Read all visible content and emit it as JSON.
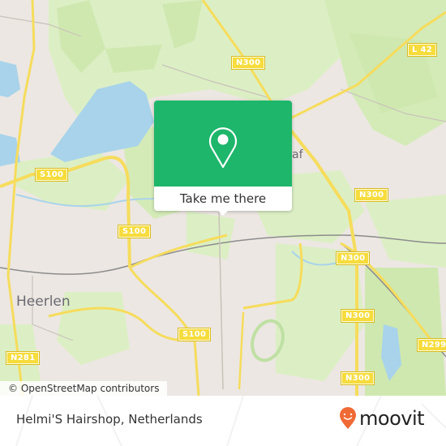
{
  "map": {
    "place_labels": [
      {
        "name": "Heerlen"
      },
      {
        "name": "af"
      }
    ],
    "road_shields": [
      "S100",
      "S100",
      "S100",
      "N300",
      "N300",
      "N300",
      "N300",
      "N300",
      "L 42",
      "N281",
      "N299"
    ],
    "colors": {
      "land": "#ece7e2",
      "forest": "#cfe8b0",
      "park": "#dcefc4",
      "water": "#a8d3ea",
      "road_major": "#f6dc5c",
      "rail": "#8c8c8c"
    }
  },
  "popup": {
    "icon": "map-pin-icon",
    "button_label": "Take me there",
    "accent": "#1db66b"
  },
  "attribution": "© OpenStreetMap contributors",
  "footer": {
    "title": "Helmi'S Hairshop, Netherlands",
    "brand": "moovit",
    "brand_color": "#f06a35"
  }
}
